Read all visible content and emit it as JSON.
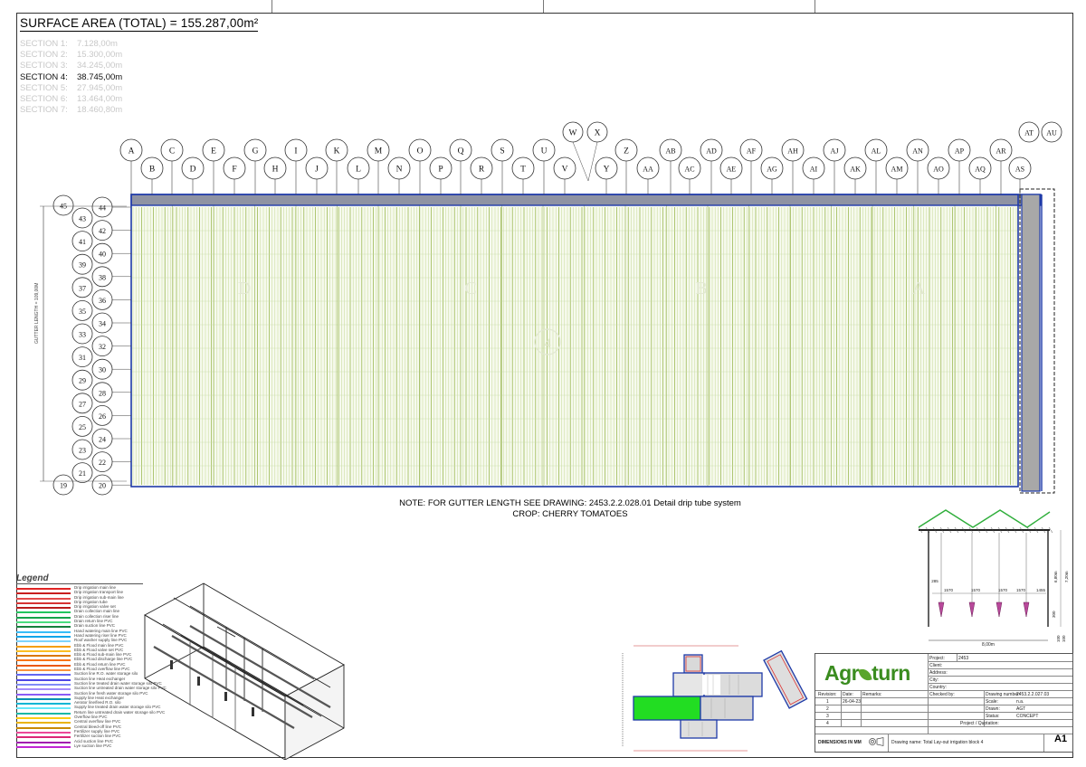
{
  "summary": {
    "surface_area": "SURFACE AREA (TOTAL) = 155.287,00m²"
  },
  "sections": [
    {
      "label": "SECTION 1:",
      "value": "7.128,00m",
      "active": false
    },
    {
      "label": "SECTION 2:",
      "value": "15.300,00m",
      "active": false
    },
    {
      "label": "SECTION 3:",
      "value": "34.245,00m",
      "active": false
    },
    {
      "label": "SECTION 4:",
      "value": "38.745,00m",
      "active": true
    },
    {
      "label": "SECTION 5:",
      "value": "27.945,00m",
      "active": false
    },
    {
      "label": "SECTION 6:",
      "value": "13.464,00m",
      "active": false
    },
    {
      "label": "SECTION 7:",
      "value": "18.460,80m",
      "active": false
    }
  ],
  "grid": {
    "top_bubbles_upper": [
      "A",
      "C",
      "E",
      "G",
      "I",
      "K",
      "M",
      "O",
      "Q",
      "S",
      "U",
      "Z",
      "AB",
      "AD",
      "AF",
      "AH",
      "AJ",
      "AL",
      "AN",
      "AP",
      "AR"
    ],
    "top_bubbles_lower": [
      "B",
      "D",
      "F",
      "H",
      "J",
      "L",
      "N",
      "P",
      "R",
      "T",
      "V",
      "Y",
      "AA",
      "AC",
      "AE",
      "AG",
      "AI",
      "AK",
      "AM",
      "AO",
      "AQ",
      "AS"
    ],
    "top_bubbles_extra": [
      "W",
      "X",
      "AT",
      "AU"
    ],
    "left_bubbles_outer": [
      "45",
      "43",
      "41",
      "39",
      "37",
      "35",
      "33",
      "31",
      "29",
      "27",
      "25",
      "23",
      "21",
      "19"
    ],
    "left_bubbles_inner": [
      "44",
      "42",
      "40",
      "38",
      "36",
      "34",
      "32",
      "30",
      "28",
      "26",
      "24",
      "22",
      "20"
    ],
    "gutter_label": "GUTTER LENGTH = 109,00M",
    "field_letters": [
      "D",
      "C",
      "B",
      "A"
    ],
    "section_marker": "4"
  },
  "note": {
    "line1": "NOTE: FOR GUTTER LENGTH SEE DRAWING: 2453.2.2.028.01 Detail drip tube system",
    "line2": "CROP: CHERRY TOMATOES"
  },
  "section_detail": {
    "dims": [
      "285",
      "1570",
      "1570",
      "1570",
      "1570",
      "1455"
    ],
    "heights": [
      "6,80m",
      "7,20m"
    ],
    "small": [
      "300",
      "100",
      "100"
    ],
    "total": "8,00m"
  },
  "legend": {
    "title": "Legend",
    "items": [
      {
        "label": "Drip irrigation main line",
        "color": "#e02424"
      },
      {
        "label": "Drip irrigation transport line",
        "color": "#c81e1e"
      },
      {
        "label": "Drip irrigation sub-main line",
        "color": "#e34a4a"
      },
      {
        "label": "Drip irrigation tube",
        "color": "#d63333"
      },
      {
        "label": "Drip irrigation valve set",
        "color": "#b91c1c"
      },
      {
        "label": "Drain collection main line",
        "color": "#22c55e"
      },
      {
        "label": "Drain collection riser line",
        "color": "#16a34a"
      },
      {
        "label": "Drain return line PVC",
        "color": "#4ade80"
      },
      {
        "label": "Drain suction line PVC",
        "color": "#15803d"
      },
      {
        "label": "Hand watering main line PVC",
        "color": "#38bdf8"
      },
      {
        "label": "Hand watering riser line PVC",
        "color": "#0ea5e9"
      },
      {
        "label": "Roof washer supply line PVC",
        "color": "#7dd3fc"
      },
      {
        "label": "Ebb & Flood main line PVC",
        "color": "#f59e0b"
      },
      {
        "label": "Ebb & Flood valve set PVC",
        "color": "#fbbf24"
      },
      {
        "label": "Ebb & Flood sub-main line PVC",
        "color": "#d97706"
      },
      {
        "label": "Ebb & Flood discharge line PVC",
        "color": "#f97316"
      },
      {
        "label": "Ebb & Flood return line PVC",
        "color": "#ea580c"
      },
      {
        "label": "Ebb & Flood overflow line PVC",
        "color": "#fb923c"
      },
      {
        "label": "Suction line R.O. water storage silo",
        "color": "#6366f1"
      },
      {
        "label": "Suction line Heat exchanger",
        "color": "#4f46e5"
      },
      {
        "label": "Suction line treated drain water storage silo PVC",
        "color": "#818cf8"
      },
      {
        "label": "Suction line untreated drain water storage silo PVC",
        "color": "#a78bfa"
      },
      {
        "label": "Suction line fresh water storage silo PVC",
        "color": "#8b5cf6"
      },
      {
        "label": "Supply line Heat exchanger",
        "color": "#0891b2"
      },
      {
        "label": "Aerator line/feed R.O. silo",
        "color": "#06b6d4"
      },
      {
        "label": "Supply line treated drain water storage silo PVC",
        "color": "#67e8f9"
      },
      {
        "label": "Return line untreated drain water storage silo PVC",
        "color": "#14b8a6"
      },
      {
        "label": "Overflow line PVC",
        "color": "#facc15"
      },
      {
        "label": "Central overflow line PVC",
        "color": "#eab308"
      },
      {
        "label": "Central bleed-off line PVC",
        "color": "#ca8a04"
      },
      {
        "label": "Fertilizer supply line PVC",
        "color": "#ec4899"
      },
      {
        "label": "Fertilizer suction line PVC",
        "color": "#db2777"
      },
      {
        "label": "Acid suction line PVC",
        "color": "#a21caf"
      },
      {
        "label": "Lye suction line PVC",
        "color": "#c026d3"
      }
    ]
  },
  "title_block": {
    "logo": {
      "pre": "Agr",
      "post": "turn"
    },
    "project_label": "Project:",
    "project_value": "2453",
    "client_label": "Client:",
    "address_label": "Address:",
    "city_label": "City:",
    "country_label": "Country:",
    "revision_label": "Revision:",
    "date_label": "Date:",
    "remarks_label": "Remarks:",
    "checked_label": "Checked by:",
    "drawing_number_label": "Drawing number:",
    "drawing_number": "2453.2.2.027.03",
    "scale_label": "Scale:",
    "scale": "n.a.",
    "drawn_label": "Drawn:",
    "drawn": "AGT",
    "status_label": "Status:",
    "status": "CONCEPT",
    "quotation_label": "Project / Quotation:",
    "revisions": [
      {
        "no": "1",
        "date": "26-04-23"
      },
      {
        "no": "2",
        "date": ""
      },
      {
        "no": "3",
        "date": ""
      },
      {
        "no": "4",
        "date": ""
      }
    ],
    "dimensions_note": "DIMENSIONS IN MM",
    "drawing_name": "Drawing name: Total Lay-out irrigation block 4",
    "sheet": "A1"
  }
}
